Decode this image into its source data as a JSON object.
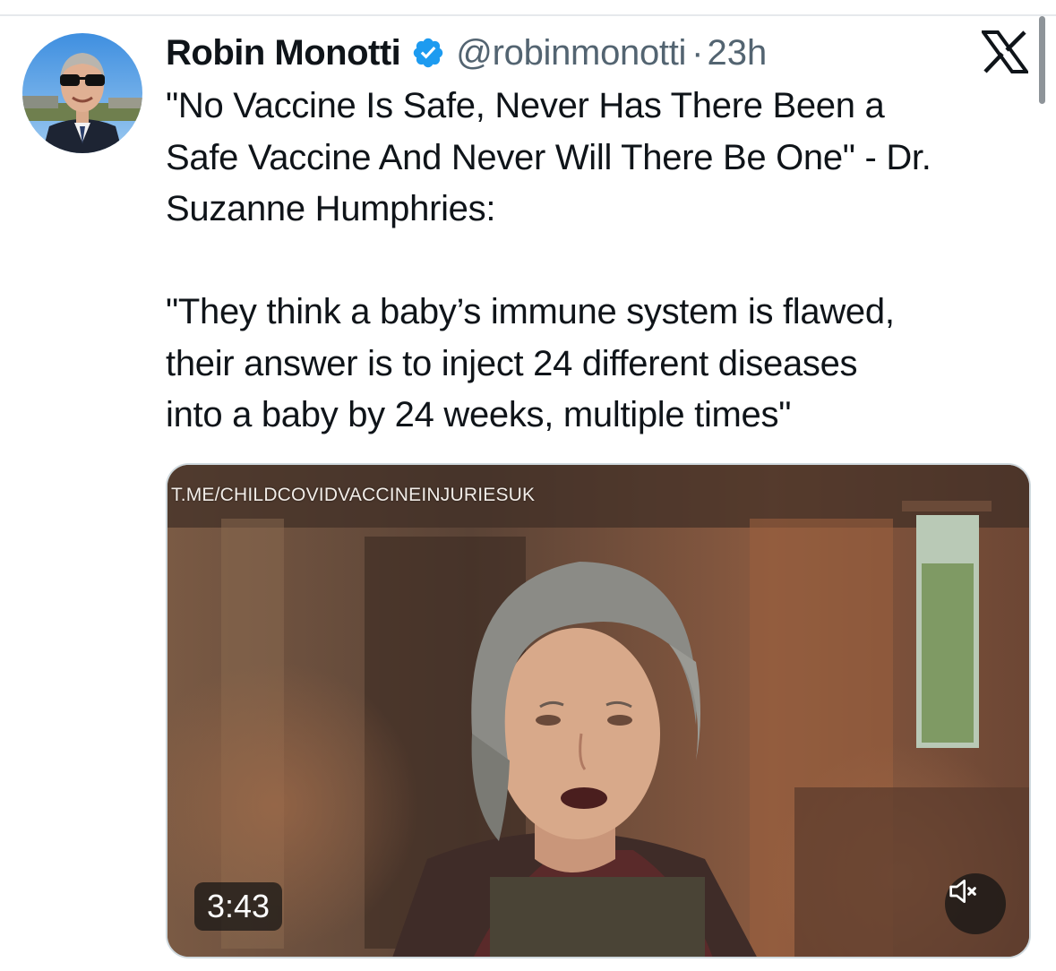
{
  "tweet": {
    "author": {
      "display_name": "Robin Monotti",
      "handle": "@robinmonotti",
      "verified": true
    },
    "separator": "·",
    "timestamp": "23h",
    "text_lines": [
      "\"No Vaccine Is Safe, Never Has There Been a\nSafe Vaccine And Never Will There Be One\" - Dr.\nSuzanne Humphries:",
      "\"They think a baby’s immune system is flawed,\ntheir answer is to inject 24 different diseases\ninto a baby by 24 weeks, multiple times\""
    ]
  },
  "media": {
    "watermark": "T.ME/CHILDCOVIDVACCINEINJURIESUK",
    "duration": "3:43",
    "mute_icon": "speaker-muted-icon"
  },
  "icons": {
    "verified": "verified-badge-icon",
    "platform": "x-logo-icon"
  },
  "colors": {
    "verified_blue": "#1d9bf0",
    "secondary_text": "#536471",
    "primary_text": "#0f1419"
  }
}
